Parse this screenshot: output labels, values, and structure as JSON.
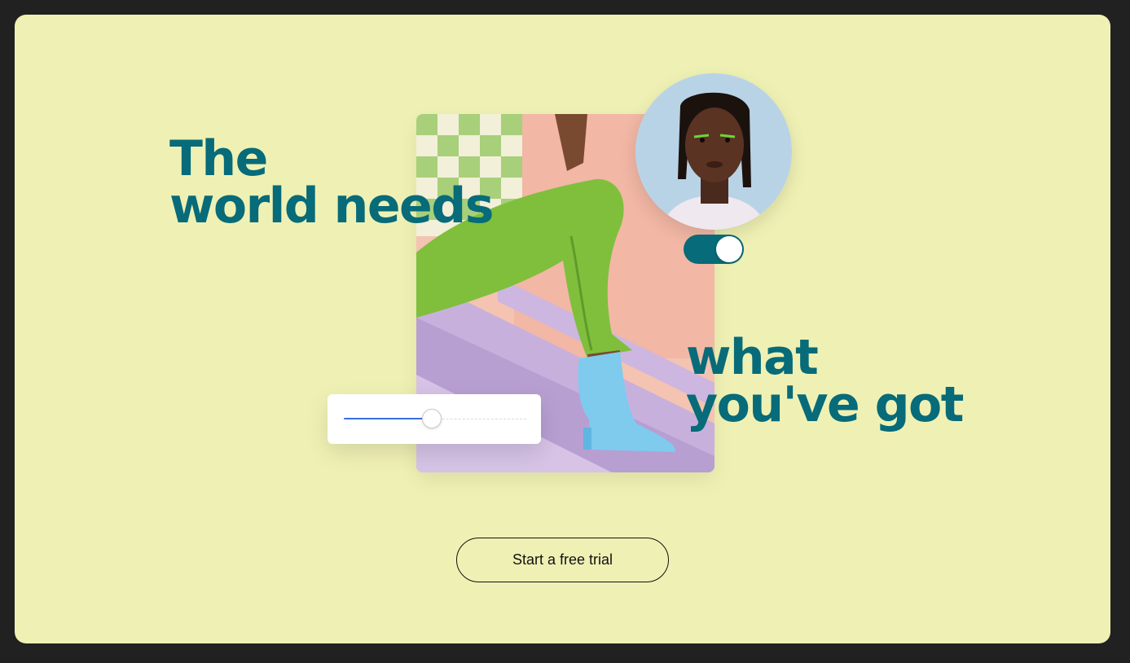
{
  "hero": {
    "headline_top": [
      "The",
      "world needs"
    ],
    "headline_bottom": [
      "what",
      "you've got"
    ]
  },
  "controls": {
    "toggle_on": true,
    "slider_value": 0.48
  },
  "cta": {
    "label": "Start a free trial"
  },
  "colors": {
    "background": "#eff1b4",
    "headline": "#076b79",
    "toggle": "#076b79",
    "slider_fill": "#3a6fe0"
  },
  "icons": [
    "toggle-switch",
    "range-slider"
  ]
}
